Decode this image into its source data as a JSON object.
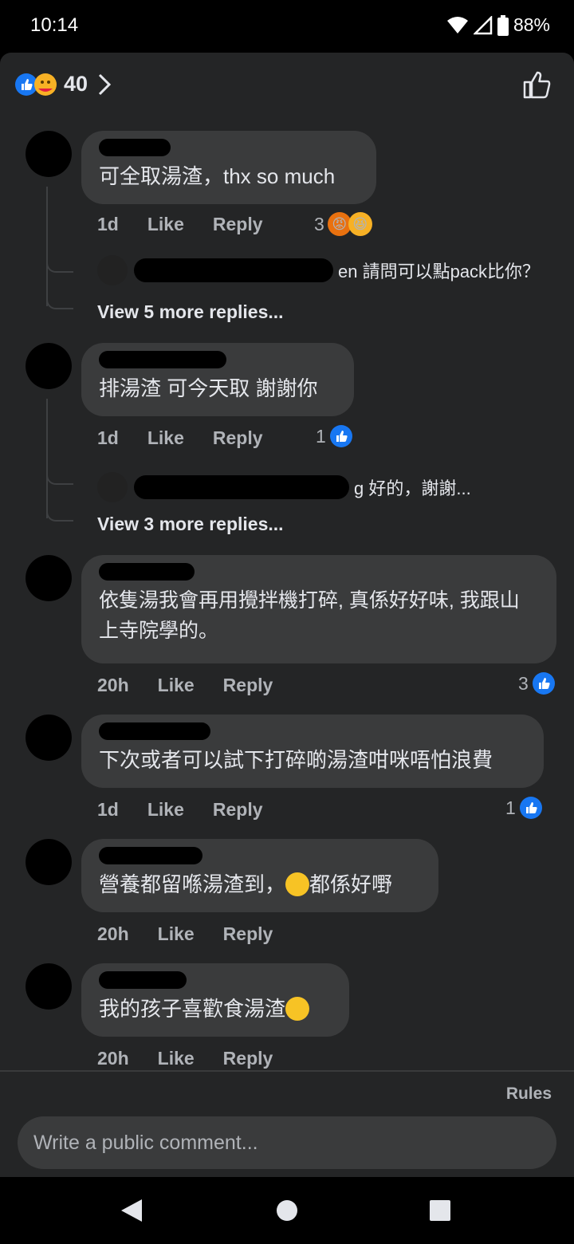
{
  "status": {
    "time": "10:14",
    "battery": "88%"
  },
  "header": {
    "reaction_count": "40"
  },
  "comments": [
    {
      "text": "可全取湯渣，thx so much",
      "age": "1d",
      "like": "Like",
      "reply": "Reply",
      "reactions": "3",
      "reply_preview": "en 請問可以點pack比你？",
      "view_more": "View 5 more replies..."
    },
    {
      "text": "排湯渣 可今天取 謝謝你",
      "age": "1d",
      "like": "Like",
      "reply": "Reply",
      "reactions": "1",
      "reply_preview": "g 好的，謝謝...",
      "view_more": "View 3 more replies..."
    },
    {
      "text": "依隻湯我會再用攪拌機打碎, 真係好好味, 我跟山上寺院學的。",
      "age": "20h",
      "like": "Like",
      "reply": "Reply",
      "reactions": "3"
    },
    {
      "text": "下次或者可以試下打碎啲湯渣咁咪唔怕浪費",
      "age": "1d",
      "like": "Like",
      "reply": "Reply",
      "reactions": "1"
    },
    {
      "text_before": "營養都留喺湯渣到，",
      "text_after": "都係好嘢",
      "age": "20h",
      "like": "Like",
      "reply": "Reply"
    },
    {
      "text": "我的孩子喜歡食湯渣",
      "age": "20h",
      "like": "Like",
      "reply": "Reply"
    }
  ],
  "footer": {
    "rules": "Rules",
    "placeholder": "Write a public comment..."
  },
  "icons": {
    "like_blue": "#1877f2",
    "angry": "#e9710f",
    "haha": "#f7b125"
  }
}
